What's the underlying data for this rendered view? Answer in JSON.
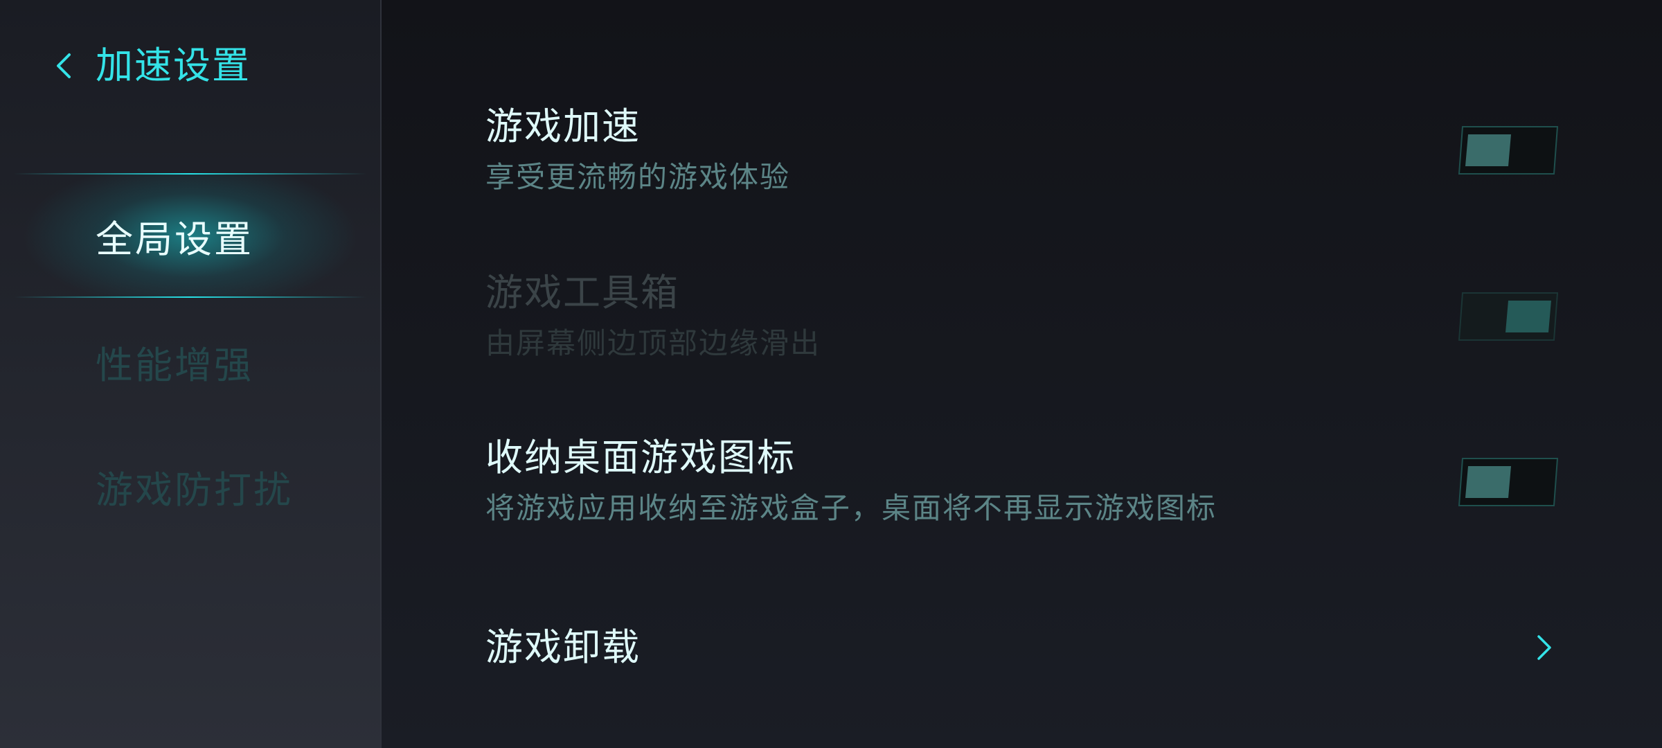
{
  "header": {
    "title": "加速设置"
  },
  "sidebar": {
    "items": [
      {
        "label": "全局设置",
        "active": true
      },
      {
        "label": "性能增强",
        "active": false
      },
      {
        "label": "游戏防打扰",
        "active": false
      }
    ]
  },
  "settings": [
    {
      "title": "游戏加速",
      "description": "享受更流畅的游戏体验",
      "control": "toggle",
      "state": "off",
      "enabled": true
    },
    {
      "title": "游戏工具箱",
      "description": "由屏幕侧边顶部边缘滑出",
      "control": "toggle",
      "state": "on",
      "enabled": false
    },
    {
      "title": "收纳桌面游戏图标",
      "description": "将游戏应用收纳至游戏盒子，桌面将不再显示游戏图标",
      "control": "toggle",
      "state": "off",
      "enabled": true
    },
    {
      "title": "游戏卸载",
      "description": "",
      "control": "chevron",
      "enabled": true
    }
  ],
  "colors": {
    "accent": "#34e3e8",
    "title_text": "#dffafa",
    "desc_text": "#5c8587",
    "sidebar_inactive": "#24474b",
    "toggle_knob": "#3a6c6a"
  },
  "icons": {
    "back": "chevron-left-icon",
    "row_arrow": "chevron-right-icon"
  }
}
